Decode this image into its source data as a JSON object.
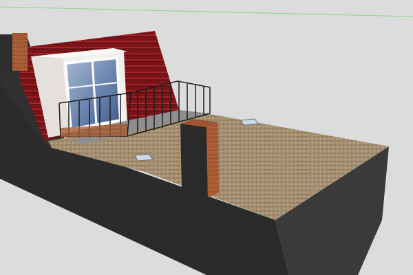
{
  "scene": {
    "subject": "rooftop terrace",
    "colors": {
      "sky": "#dcdcdc",
      "horizon": "#8fd18f",
      "wall_dark": "#2b2b2b",
      "wall_front": "#363636",
      "roof_tile": "#7a1418",
      "roof_tile_light": "#a0262a",
      "brick": "#b3643b",
      "terrace_floor": "#a08c70",
      "dormer_white": "#f2f0ec",
      "glass": "#6f88b2",
      "railing": "#1c1c1c"
    }
  }
}
